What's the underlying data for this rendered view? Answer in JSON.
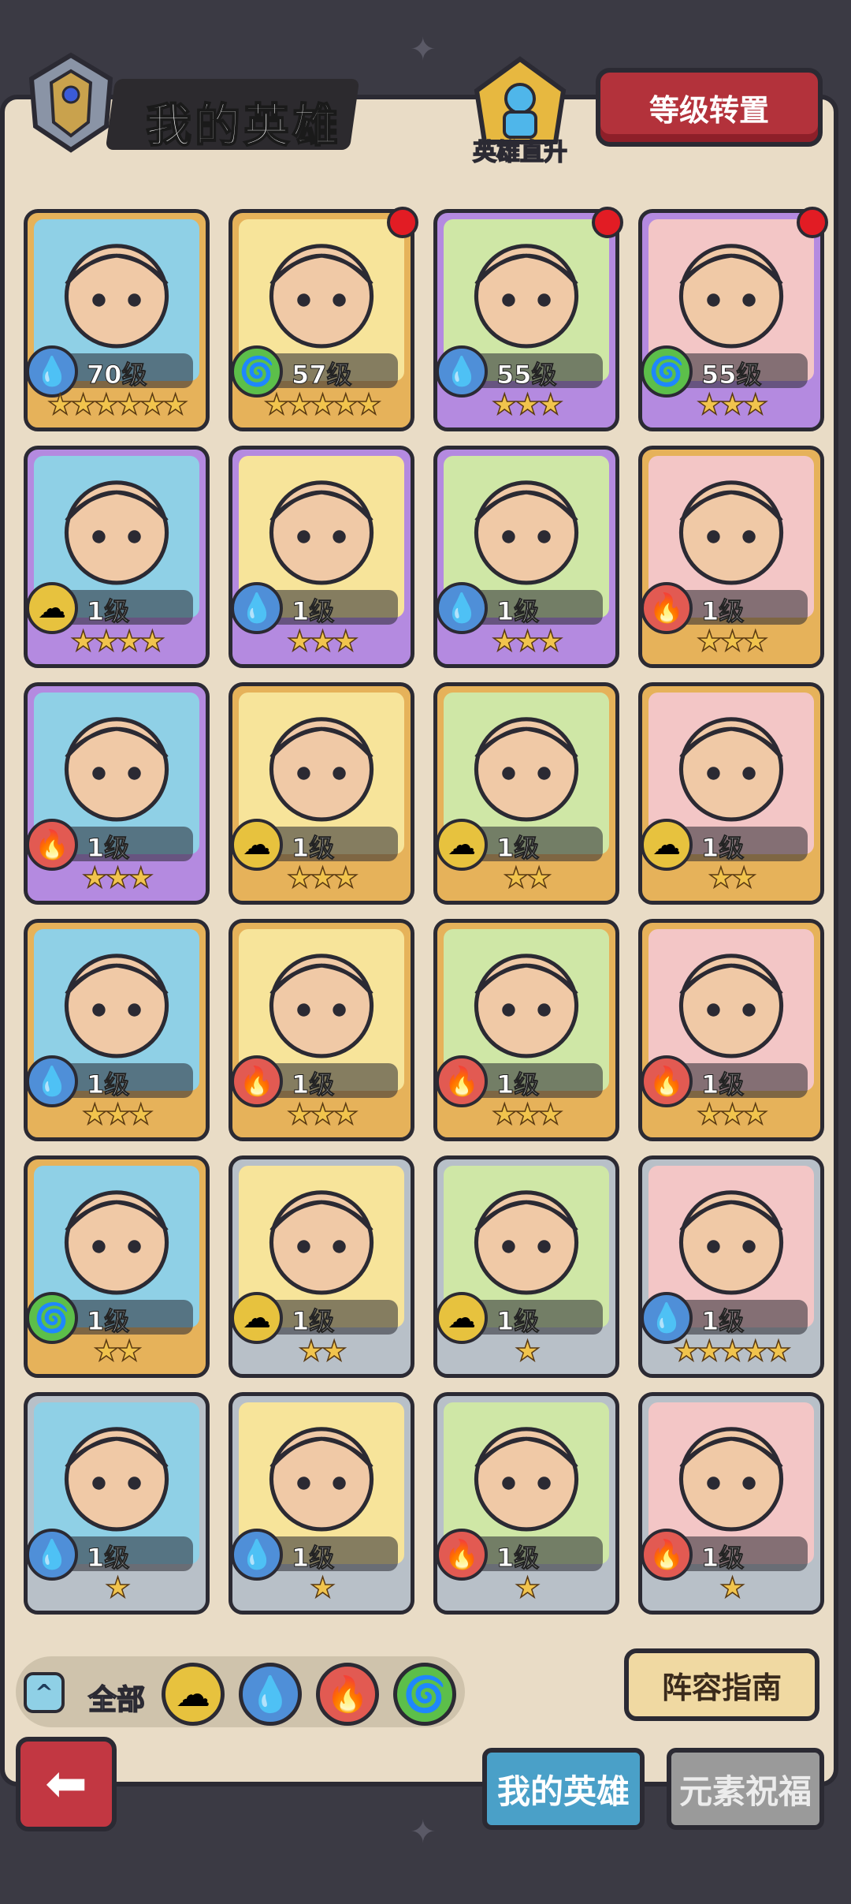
{
  "header": {
    "title": "我的英雄",
    "promote_label": "英雄直升",
    "reset_button": "等级转置"
  },
  "heroes": [
    {
      "level": "70级",
      "stars": "★★★★★★",
      "element": "water",
      "dot": false
    },
    {
      "level": "57级",
      "stars": "★★★★★",
      "element": "wind",
      "dot": true
    },
    {
      "level": "55级",
      "stars": "★★★",
      "element": "water",
      "dot": true
    },
    {
      "level": "55级",
      "stars": "★★★",
      "element": "wind",
      "dot": true
    },
    {
      "level": "1级",
      "stars": "★★★★",
      "element": "earth",
      "dot": false
    },
    {
      "level": "1级",
      "stars": "★★★",
      "element": "water",
      "dot": false
    },
    {
      "level": "1级",
      "stars": "★★★",
      "element": "water",
      "dot": false
    },
    {
      "level": "1级",
      "stars": "★★★",
      "element": "fire",
      "dot": false
    },
    {
      "level": "1级",
      "stars": "★★★",
      "element": "fire",
      "dot": false
    },
    {
      "level": "1级",
      "stars": "★★★",
      "element": "earth",
      "dot": false
    },
    {
      "level": "1级",
      "stars": "★★",
      "element": "earth",
      "dot": false
    },
    {
      "level": "1级",
      "stars": "★★",
      "element": "earth",
      "dot": false
    },
    {
      "level": "1级",
      "stars": "★★★",
      "element": "water",
      "dot": false
    },
    {
      "level": "1级",
      "stars": "★★★",
      "element": "fire",
      "dot": false
    },
    {
      "level": "1级",
      "stars": "★★★",
      "element": "fire",
      "dot": false
    },
    {
      "level": "1级",
      "stars": "★★★",
      "element": "fire",
      "dot": false
    },
    {
      "level": "1级",
      "stars": "★★",
      "element": "wind",
      "dot": false
    },
    {
      "level": "1级",
      "stars": "★★",
      "element": "earth",
      "dot": false
    },
    {
      "level": "1级",
      "stars": "★",
      "element": "earth",
      "dot": false
    },
    {
      "level": "1级",
      "stars": "★★★★★",
      "element": "water",
      "dot": false
    },
    {
      "level": "1级",
      "stars": "★",
      "element": "water",
      "dot": false
    },
    {
      "level": "1级",
      "stars": "★",
      "element": "water",
      "dot": false
    },
    {
      "level": "1级",
      "stars": "★",
      "element": "fire",
      "dot": false
    },
    {
      "level": "1级",
      "stars": "★",
      "element": "fire",
      "dot": false
    }
  ],
  "filters": {
    "all_label": "全部",
    "options": [
      "earth",
      "water",
      "fire",
      "wind"
    ]
  },
  "guide_button": "阵容指南",
  "tabs": {
    "my_heroes": "我的英雄",
    "element_blessing": "元素祝福"
  },
  "colors": {
    "gold_frame": "#e6b25a",
    "purple_frame": "#b48ae0",
    "silver_frame": "#b8c0c8",
    "fire": "#e25a52",
    "water": "#4f8fd8",
    "wind": "#5cbf4a",
    "earth": "#e7c23e"
  }
}
